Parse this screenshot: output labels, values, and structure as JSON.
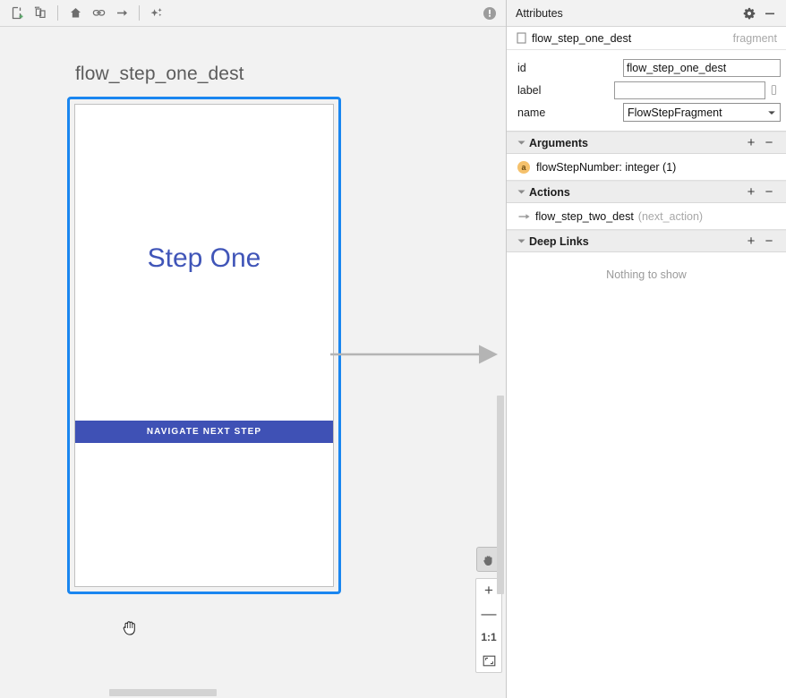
{
  "toolbar": {
    "buttons": [
      {
        "name": "new-destination-icon",
        "title": "New Destination"
      },
      {
        "name": "new-nested-graph-icon",
        "title": "New Nested Graph"
      },
      {
        "name": "home-icon",
        "title": "Assign start destination"
      },
      {
        "name": "link-icon",
        "title": "Add action"
      },
      {
        "name": "arrow-right-icon",
        "title": "Add action"
      },
      {
        "name": "auto-arrange-icon",
        "title": "Auto Arrange"
      }
    ],
    "status_icon": "error-info-icon"
  },
  "canvas": {
    "destination_title": "flow_step_one_dest",
    "screen": {
      "title": "Step One",
      "button_label": "NAVIGATE NEXT STEP"
    },
    "zoom_controls": {
      "pan_label": "pan-tool",
      "zoom_in": "+",
      "zoom_out": "—",
      "actual_size": "1:1",
      "fit_to_screen": "fit-icon"
    }
  },
  "attributes": {
    "header": {
      "title": "Attributes",
      "gear_icon": "gear-icon",
      "minimize_icon": "minimize-icon"
    },
    "selection": {
      "icon": "fragment-icon",
      "name": "flow_step_one_dest",
      "type": "fragment"
    },
    "properties": [
      {
        "label": "id",
        "value": "flow_step_one_dest",
        "kind": "text"
      },
      {
        "label": "label",
        "value": "",
        "kind": "text",
        "has_picker": true
      },
      {
        "label": "name",
        "value": "FlowStepFragment",
        "kind": "combo"
      }
    ],
    "sections": [
      {
        "title": "Arguments",
        "add_label": "+",
        "remove_label": "−",
        "rows": [
          {
            "badge": "a",
            "text": "flowStepNumber: integer (1)",
            "muted": ""
          }
        ]
      },
      {
        "title": "Actions",
        "add_label": "+",
        "remove_label": "−",
        "rows": [
          {
            "icon": "action-arrow-icon",
            "text": "flow_step_two_dest",
            "muted": "(next_action)"
          }
        ]
      },
      {
        "title": "Deep Links",
        "add_label": "+",
        "remove_label": "−",
        "rows": []
      }
    ],
    "empty_message": "Nothing to show"
  },
  "colors": {
    "selection_blue": "#1a86f0",
    "screen_title": "#4055b8",
    "button_bg": "#3f51b5",
    "argument_badge": "#f5c16c",
    "connector": "#b4b4b4"
  }
}
